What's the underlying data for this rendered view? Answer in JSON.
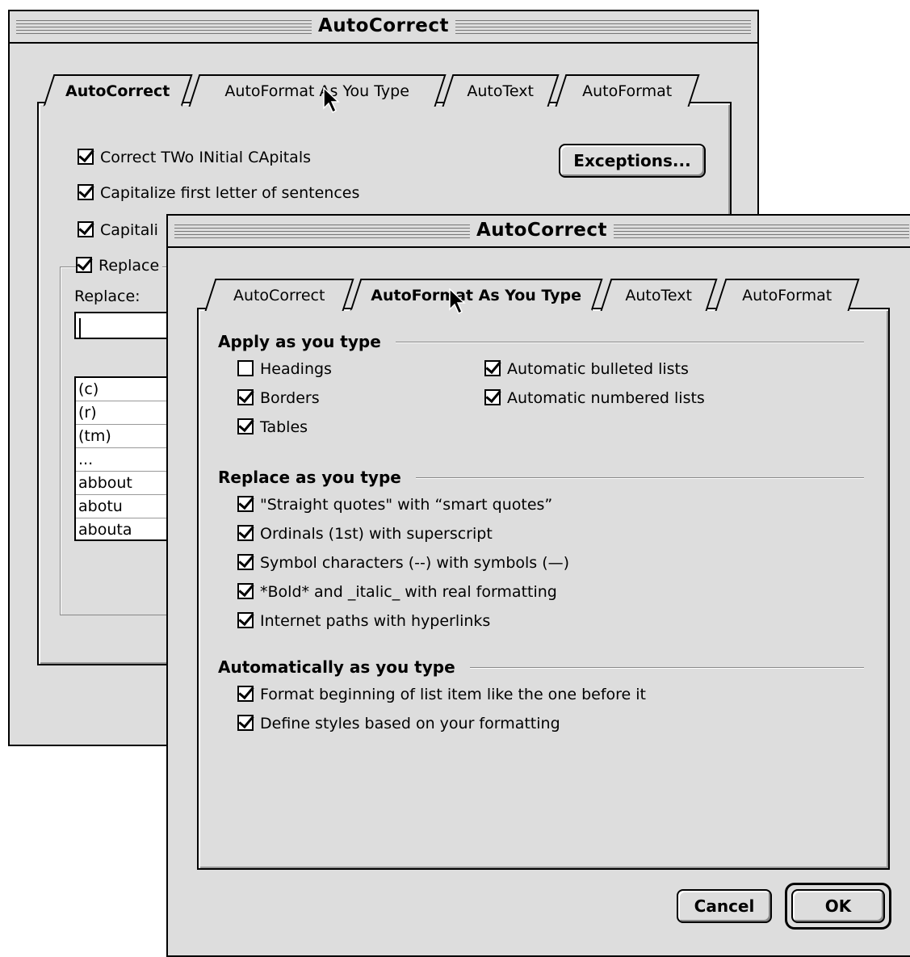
{
  "back_window": {
    "title": "AutoCorrect",
    "tabs": [
      "AutoCorrect",
      "AutoFormat As You Type",
      "AutoText",
      "AutoFormat"
    ],
    "options": [
      {
        "label": "Correct TWo INitial CApitals",
        "checked": true
      },
      {
        "label": "Capitalize first letter of sentences",
        "checked": true
      },
      {
        "label": "Capitali",
        "checked": true
      },
      {
        "label": "Replace",
        "checked": true
      }
    ],
    "exceptions_button": "Exceptions...",
    "replace_label": "Replace:",
    "replace_value": "",
    "list": [
      "(c)",
      "(r)",
      "(tm)",
      "...",
      "abbout",
      "abotu",
      "abouta"
    ]
  },
  "front_window": {
    "title": "AutoCorrect",
    "tabs": [
      "AutoCorrect",
      "AutoFormat As You Type",
      "AutoText",
      "AutoFormat"
    ],
    "groups": {
      "apply": {
        "heading": "Apply as you type",
        "left": [
          {
            "label": "Headings",
            "checked": false
          },
          {
            "label": "Borders",
            "checked": true
          },
          {
            "label": "Tables",
            "checked": true
          }
        ],
        "right": [
          {
            "label": "Automatic bulleted lists",
            "checked": true
          },
          {
            "label": "Automatic numbered lists",
            "checked": true
          }
        ]
      },
      "replace": {
        "heading": "Replace as you type",
        "items": [
          {
            "label": "\"Straight quotes\" with “smart quotes”",
            "checked": true
          },
          {
            "label": "Ordinals (1st) with superscript",
            "checked": true
          },
          {
            "label": "Symbol characters (--) with symbols (—)",
            "checked": true
          },
          {
            "label": "*Bold* and _italic_ with real formatting",
            "checked": true
          },
          {
            "label": "Internet paths with hyperlinks",
            "checked": true
          }
        ]
      },
      "auto": {
        "heading": "Automatically as you type",
        "items": [
          {
            "label": "Format beginning of list item like the one before it",
            "checked": true
          },
          {
            "label": "Define styles based on your formatting",
            "checked": true
          }
        ]
      }
    },
    "cancel_button": "Cancel",
    "ok_button": "OK"
  }
}
